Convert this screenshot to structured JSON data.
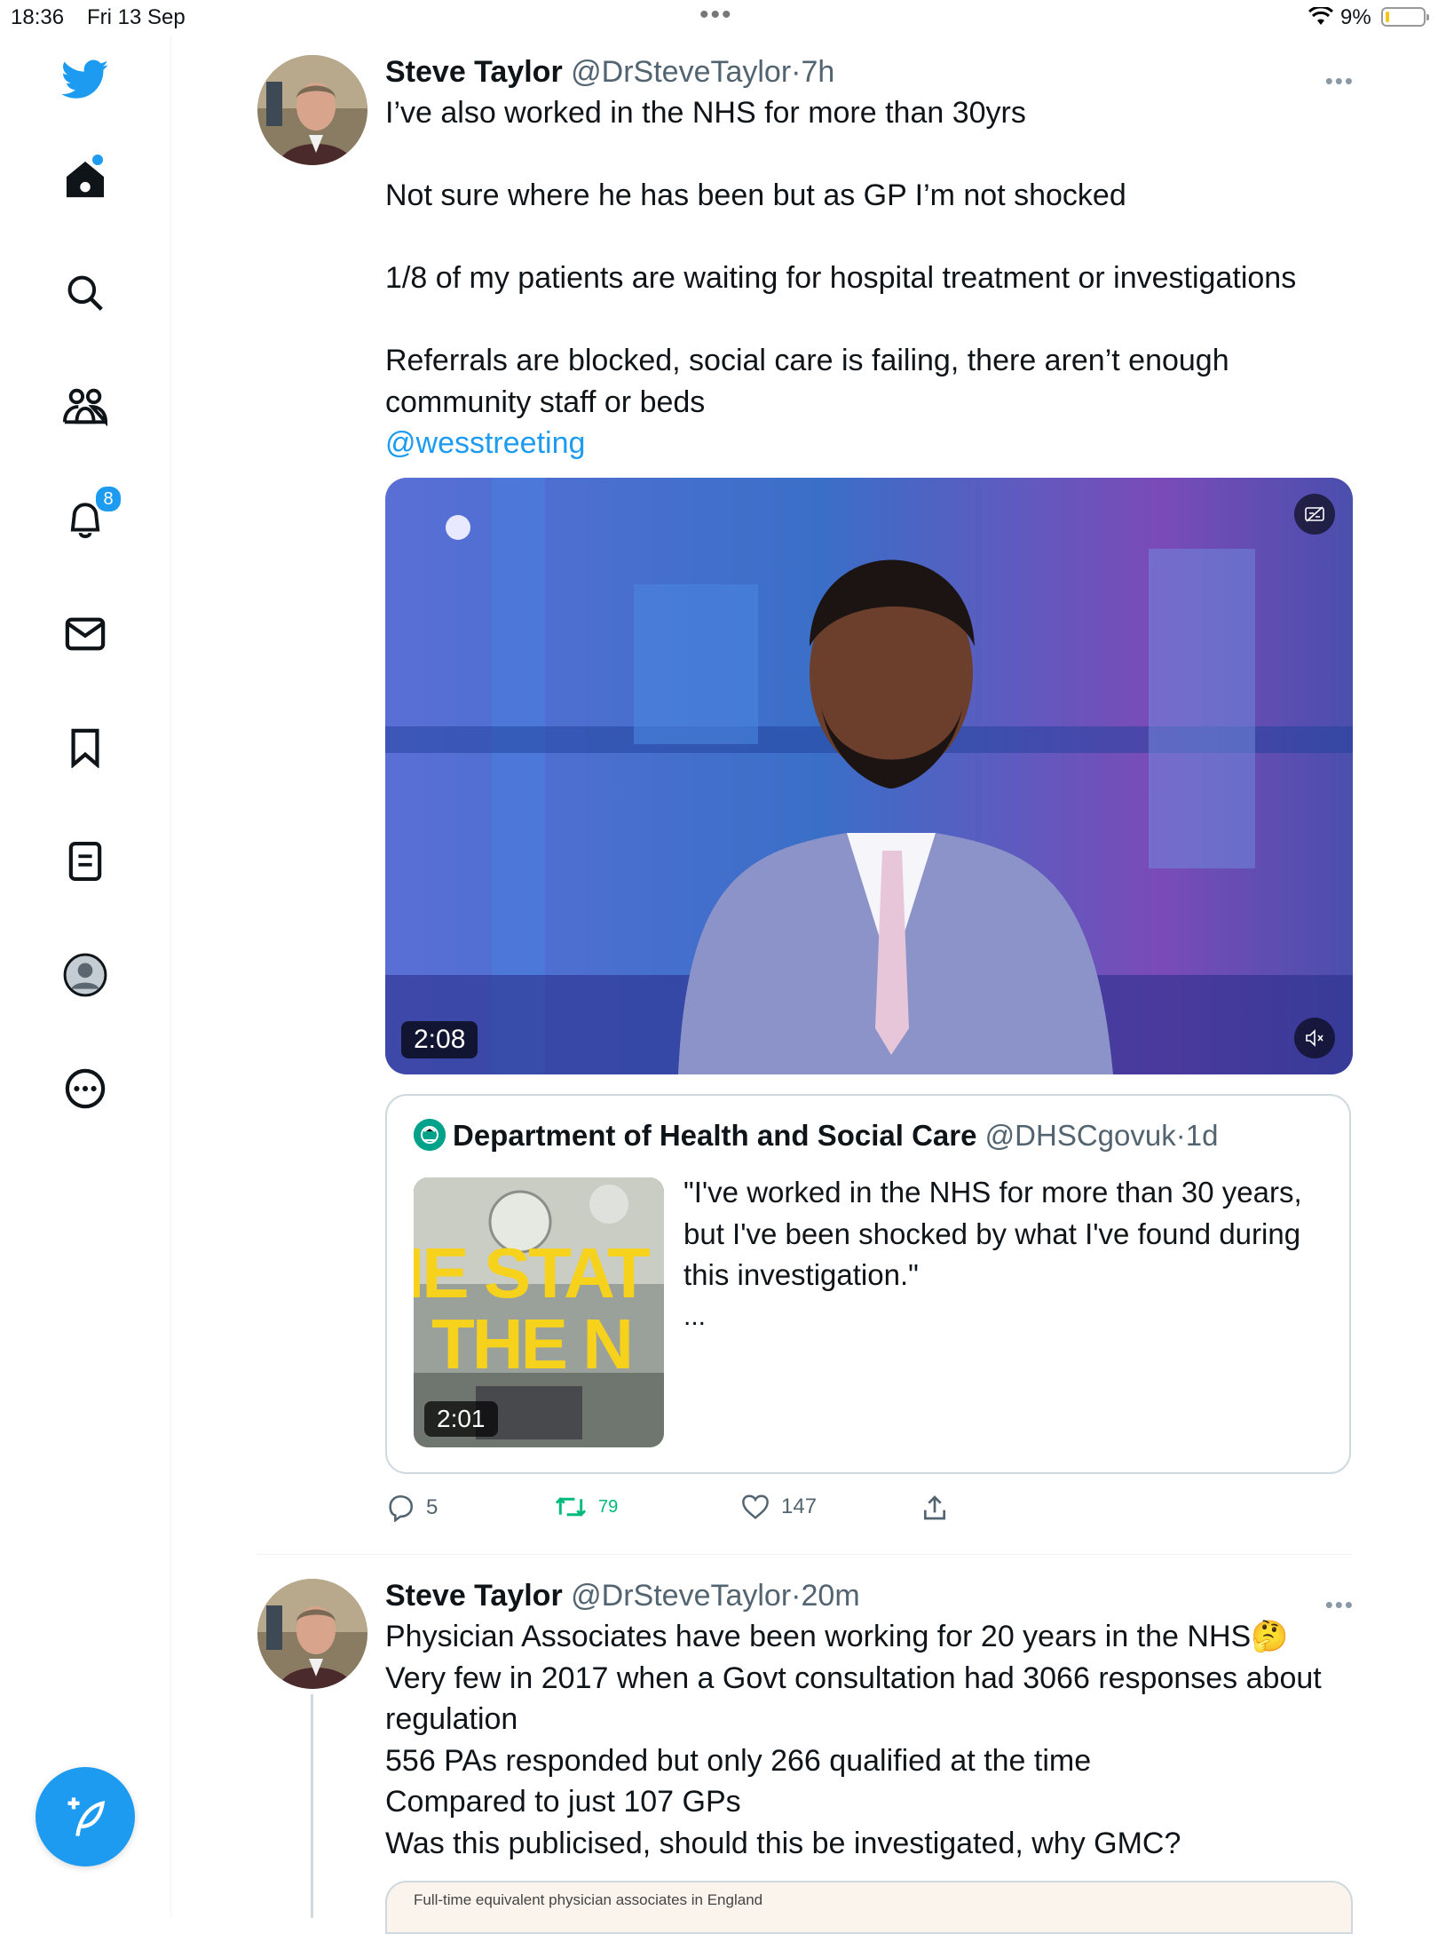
{
  "status_bar": {
    "time": "18:36",
    "date": "Fri 13 Sep",
    "battery": "9%"
  },
  "sidebar": {
    "notifications_badge": "8",
    "items": [
      "twitter-logo",
      "home-icon",
      "search-icon",
      "communities-icon",
      "notifications-icon",
      "messages-icon",
      "bookmarks-icon",
      "lists-icon",
      "profile-icon",
      "more-icon"
    ]
  },
  "tweets": [
    {
      "name": "Steve Taylor",
      "handle": "@DrSteveTaylor",
      "sep": "·",
      "time": "7h",
      "paragraphs": [
        "I’ve also worked in the NHS for more than 30yrs",
        "Not sure where he has been but as GP I’m not shocked",
        "1/8 of my patients are waiting for hospital treatment or investigations",
        "Referrals are blocked, social care is failing, there aren’t enough community staff or beds"
      ],
      "mention": "@wesstreeting",
      "video_duration": "2:08",
      "quote": {
        "name": "Department of Health and Social Care",
        "handle": "@DHSCgovuk",
        "sep": "·",
        "time": "1d",
        "text": "\"I've worked in the NHS for more than 30 years, but I've been shocked by what I've found during this investigation.\"",
        "ellipsis": "...",
        "thumb_text_1": "IE STAT",
        "thumb_text_2": "THE N",
        "thumb_duration": "2:01"
      },
      "actions": {
        "replies": "5",
        "retweets": "79",
        "likes": "147"
      }
    },
    {
      "name": "Steve Taylor",
      "handle": "@DrSteveTaylor",
      "sep": "·",
      "time": "20m",
      "lines": [
        "Physician Associates have been working for 20 years in the NHS🤔",
        "Very few in 2017 when a Govt consultation had 3066 responses about regulation",
        "556 PAs responded but only 266 qualified at the time",
        "Compared to just 107 GPs",
        "Was this publicised, should this be investigated, why GMC?"
      ],
      "card_caption": "Full-time equivalent physician associates in England"
    }
  ],
  "colors": {
    "accent": "#1d9bf0",
    "text": "#0f1419",
    "muted": "#536471",
    "retweet_green": "#00ba7c"
  }
}
